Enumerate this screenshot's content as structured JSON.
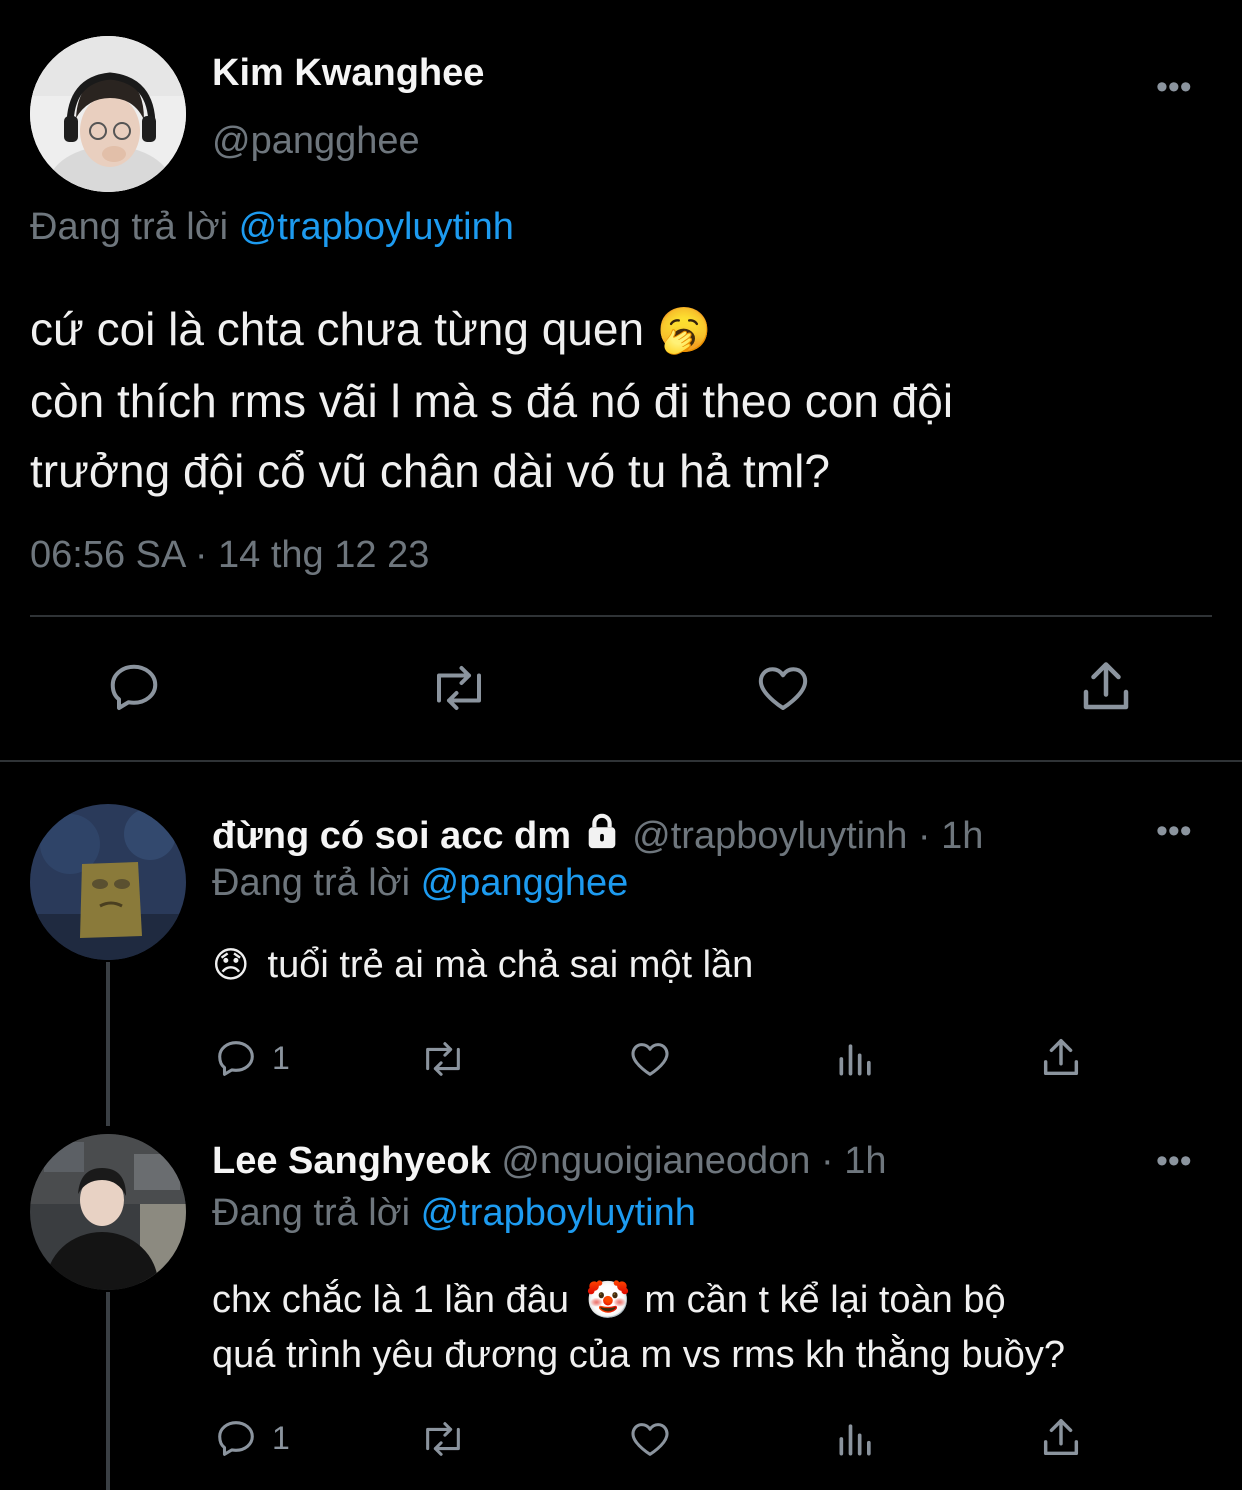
{
  "main_tweet": {
    "display_name": "Kim Kwanghee",
    "handle": "@pangghee",
    "replying_prefix": "Đang trả lời",
    "replying_to": "@trapboyluytinh",
    "text_line1": "cứ coi là chta chưa từng quen",
    "text_emoji": "🥱",
    "text_line2": "còn thích rms vãi l mà s đá nó đi theo con đội",
    "text_line3": "trưởng đội cổ vũ chân dài vó tu hả tml?",
    "timestamp": "06:56 SA",
    "separator": "·",
    "date": "14 thg 12 23",
    "more": "•••"
  },
  "replies": [
    {
      "display_name": "đừng có soi acc dm",
      "lock_icon": "lock-icon",
      "handle": "@trapboyluytinh",
      "sep": "·",
      "time": "1h",
      "replying_prefix": "Đang trả lời",
      "replying_to": "@pangghee",
      "emoji": "😞",
      "text": "tuổi trẻ ai mà chả sai một lần",
      "reply_count": "1",
      "more": "•••"
    },
    {
      "display_name": "Lee Sanghyeok",
      "handle": "@nguoigianeodon",
      "sep": "·",
      "time": "1h",
      "replying_prefix": "Đang trả lời",
      "replying_to": "@trapboyluytinh",
      "text_a": "chx chắc là 1 lần đâu",
      "emoji": "🤡",
      "text_b": "m cần t kể lại toàn bộ",
      "text_c": "quá trình yêu đương của m vs rms kh thằng buồy?",
      "reply_count": "1",
      "more": "•••"
    }
  ],
  "colors": {
    "background": "#000000",
    "text": "#e7e9ea",
    "muted": "#6e767d",
    "link": "#1d9bf0",
    "divider": "#2f3336"
  }
}
